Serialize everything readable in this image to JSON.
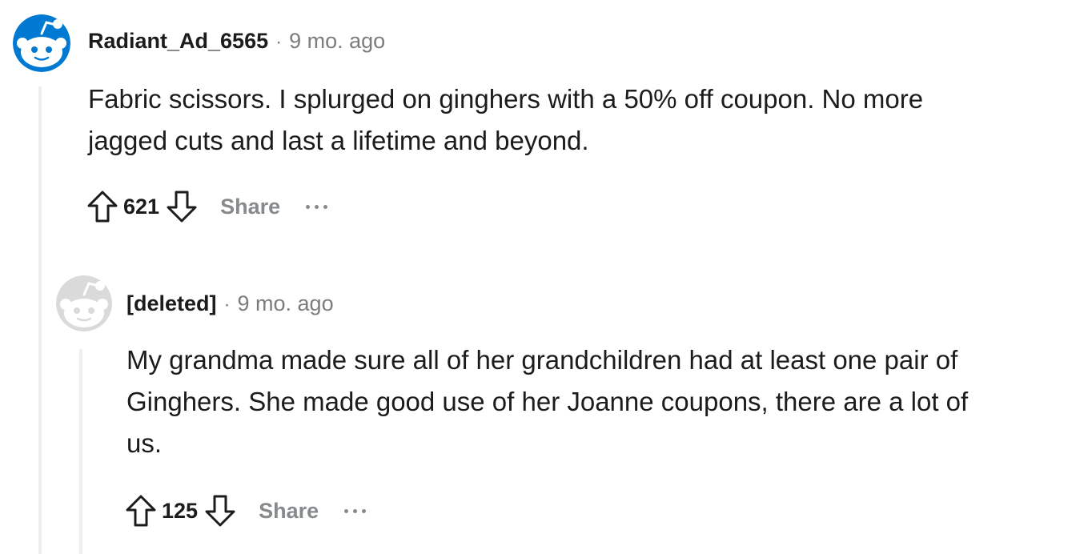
{
  "comments": [
    {
      "author": "Radiant_Ad_6565",
      "separator": "·",
      "time": "9 mo. ago",
      "body_line1": "Fabric scissors. I splurged on ginghers with a 50% off coupon. No more",
      "body_line2": "jagged cuts and last a lifetime and beyond.",
      "score": "621",
      "share_label": "Share",
      "avatar_icon": "snoo-avatar-icon",
      "avatar_color": "#0079d3"
    },
    {
      "author": "[deleted]",
      "separator": "·",
      "time": "9 mo. ago",
      "body_line1": "My grandma made sure all of her grandchildren had at least one pair of",
      "body_line2": "Ginghers. She made good use of her Joanne coupons, there are a lot of",
      "body_line3": "us.",
      "score": "125",
      "share_label": "Share",
      "avatar_icon": "deleted-snoo-avatar-icon",
      "avatar_color": "#dadada"
    }
  ],
  "colors": {
    "text": "#1c1c1c",
    "meta": "#7c7c7c",
    "action": "#878a8c",
    "thread_line": "#edeff1"
  }
}
